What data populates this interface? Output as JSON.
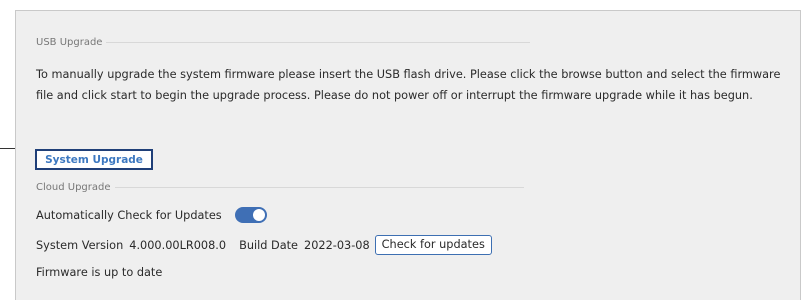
{
  "usb": {
    "title": "USB Upgrade",
    "description": "To manually upgrade the system firmware please insert the USB flash drive. Please click the browse button and select the firmware file and click start to begin the upgrade process. Please do not power off or interrupt the firmware upgrade while it has begun.",
    "system_upgrade_label": "System Upgrade"
  },
  "cloud": {
    "title": "Cloud Upgrade",
    "auto_check_label": "Automatically Check for Updates",
    "auto_check_enabled": true,
    "system_version_label": "System Version",
    "system_version_value": "4.000.00LR008.0",
    "build_date_label": "Build Date",
    "build_date_value": "2022-03-08",
    "check_button_label": "Check for updates",
    "status_text": "Firmware is up to date"
  },
  "colors": {
    "accent": "#3f6fb5",
    "button_border": "#1f3f78",
    "panel_bg": "#efefef"
  }
}
